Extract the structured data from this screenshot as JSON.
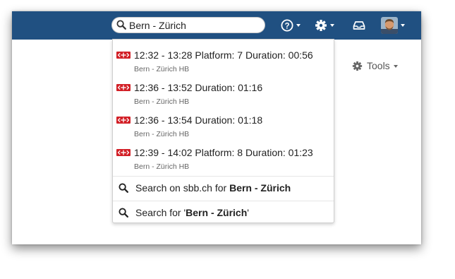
{
  "search": {
    "value": "Bern - Zürich"
  },
  "header": {
    "help_icon": "question-circle-icon",
    "settings_icon": "gear-icon",
    "inbox_icon": "inbox-tray-icon",
    "avatar": "user-avatar"
  },
  "tools": {
    "label": "Tools",
    "icon": "gear-icon"
  },
  "results": [
    {
      "title": "12:32 - 13:28 Platform: 7 Duration: 00:56",
      "subtitle": "Bern - Zürich HB"
    },
    {
      "title": "12:36 - 13:52 Duration: 01:16",
      "subtitle": "Bern - Zürich HB"
    },
    {
      "title": "12:36 - 13:54 Duration: 01:18",
      "subtitle": "Bern - Zürich HB"
    },
    {
      "title": "12:39 - 14:02 Platform: 8 Duration: 01:23",
      "subtitle": "Bern - Zürich HB"
    }
  ],
  "actions": {
    "sbb": {
      "prefix": "Search on sbb.ch for ",
      "query": "Bern - Zürich"
    },
    "general": {
      "prefix": "Search for '",
      "query": "Bern - Zürich",
      "suffix": "'"
    }
  },
  "colors": {
    "header": "#205081",
    "sbb_red": "#d21f26"
  }
}
